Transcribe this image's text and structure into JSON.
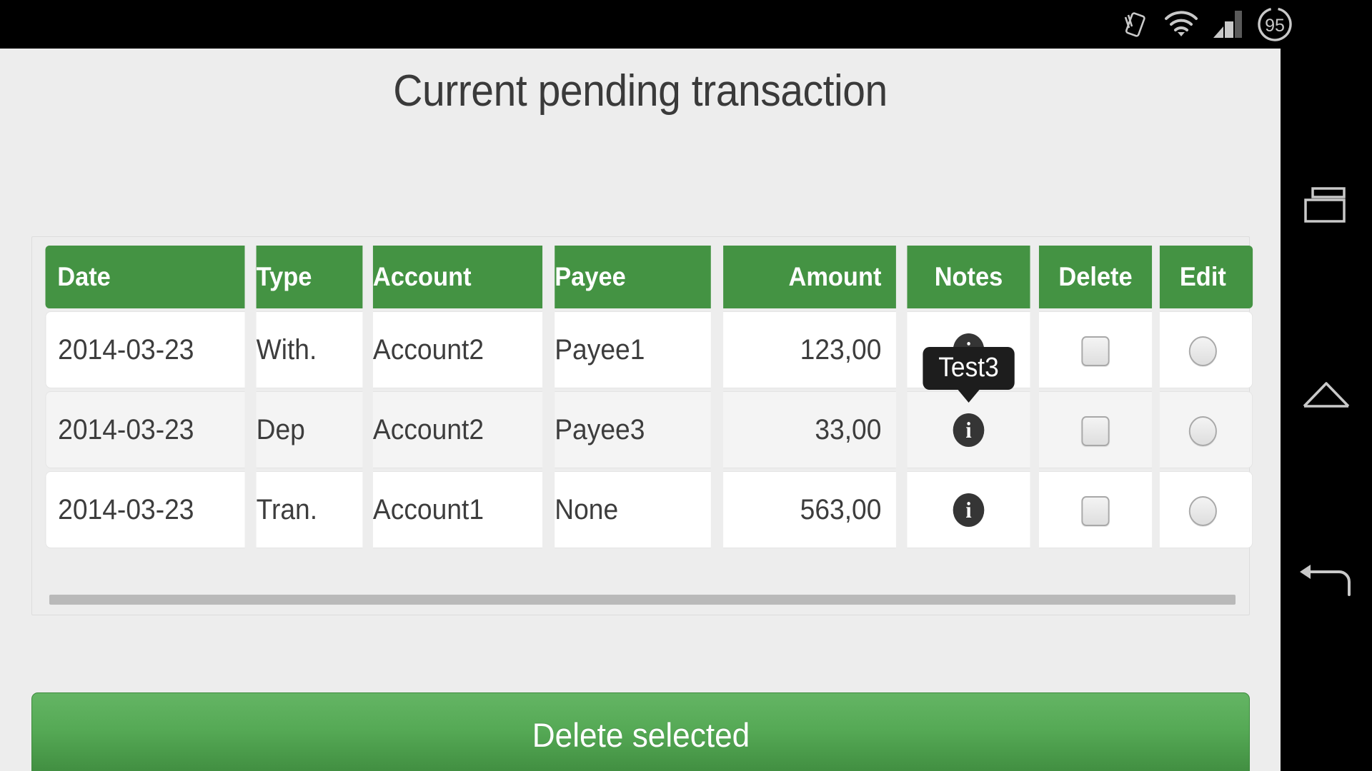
{
  "status_bar": {
    "icons": [
      "rotate-phone-icon",
      "wifi-icon",
      "cellular-signal-icon",
      "battery-icon"
    ],
    "battery_level": "95"
  },
  "page": {
    "title": "Current pending transaction"
  },
  "table": {
    "columns": [
      "Date",
      "Type",
      "Account",
      "Payee",
      "Amount",
      "Notes",
      "Delete",
      "Edit"
    ],
    "rows": [
      {
        "date": "2014-03-23",
        "type": "With.",
        "account": "Account2",
        "payee": "Payee1",
        "amount": "123,00",
        "notes_icon": "info-icon",
        "delete_checked": false,
        "edit_selected": false
      },
      {
        "date": "2014-03-23",
        "type": "Dep",
        "account": "Account2",
        "payee": "Payee3",
        "amount": "33,00",
        "notes_icon": "info-icon",
        "delete_checked": false,
        "edit_selected": false
      },
      {
        "date": "2014-03-23",
        "type": "Tran.",
        "account": "Account1",
        "payee": "None",
        "amount": "563,00",
        "notes_icon": "info-icon",
        "delete_checked": false,
        "edit_selected": false
      }
    ]
  },
  "tooltip": {
    "text": "Test3",
    "attached_to_row": 2
  },
  "footer": {
    "delete_selected_label": "Delete selected"
  },
  "nav_bar": {
    "buttons": [
      "recent-apps-icon",
      "home-icon",
      "back-icon"
    ]
  },
  "colors": {
    "header_green": "#449343",
    "button_green_top": "#64b564",
    "button_green_bottom": "#3f8c3f",
    "page_background": "#ededed",
    "title_text": "#3a3a3a",
    "tooltip_bg": "#1d1d1d",
    "info_icon_bg": "#353535",
    "scrollbar_thumb": "#b9b9b9"
  }
}
